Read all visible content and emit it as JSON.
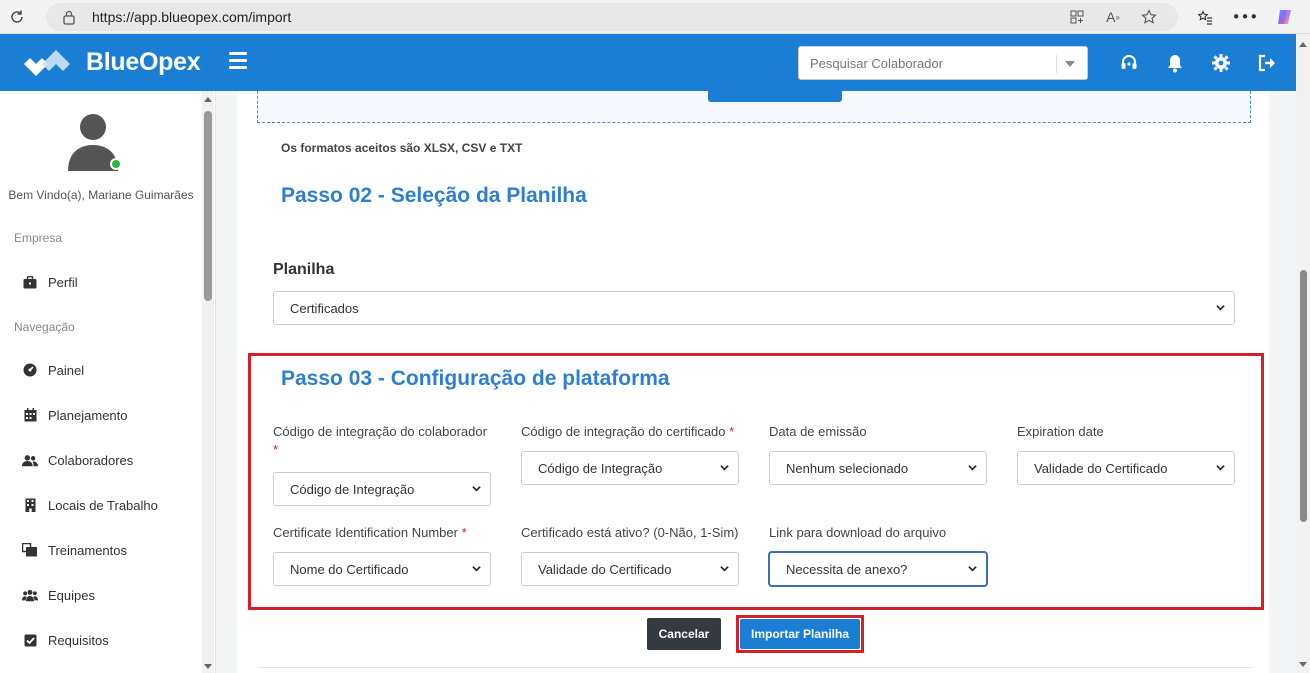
{
  "browser": {
    "url": "https://app.blueopex.com/import"
  },
  "header": {
    "brand": "BlueOpex",
    "search_placeholder": "Pesquisar Colaborador"
  },
  "sidebar": {
    "welcome": "Bem Vindo(a), Mariane Guimarães",
    "section_company": "Empresa",
    "section_nav": "Navegação",
    "items": [
      {
        "label": "Perfil",
        "icon": "briefcase-icon"
      },
      {
        "label": "Painel",
        "icon": "dashboard-icon"
      },
      {
        "label": "Planejamento",
        "icon": "calendar-icon"
      },
      {
        "label": "Colaboradores",
        "icon": "users-icon"
      },
      {
        "label": "Locais de Trabalho",
        "icon": "building-icon"
      },
      {
        "label": "Treinamentos",
        "icon": "training-icon"
      },
      {
        "label": "Equipes",
        "icon": "team-icon"
      },
      {
        "label": "Requisitos",
        "icon": "checkbox-icon"
      }
    ]
  },
  "main": {
    "formats_note": "Os formatos aceitos são XLSX, CSV e TXT",
    "step2_title": "Passo 02 - Seleção da Planilha",
    "sheet_label": "Planilha",
    "sheet_value": "Certificados",
    "step3_title": "Passo 03 - Configuração de plataforma",
    "fields": [
      {
        "label": "Código de integração do colaborador",
        "required": "*",
        "value": "Código de Integração"
      },
      {
        "label": "Código de integração do certificado",
        "required": "*",
        "value": "Código de Integração"
      },
      {
        "label": "Data de emissão",
        "required": "",
        "value": "Nenhum selecionado"
      },
      {
        "label": "Expiration date",
        "required": "",
        "value": "Validade do Certificado"
      },
      {
        "label": "Certificate Identification Number",
        "required": "*",
        "value": "Nome do Certificado"
      },
      {
        "label": "Certificado está ativo? (0-Não, 1-Sim)",
        "required": "",
        "value": "Validade do Certificado"
      },
      {
        "label": "Link para download do arquivo",
        "required": "",
        "value": "Necessita de anexo?"
      }
    ],
    "cancel_label": "Cancelar",
    "import_label": "Importar Planilha"
  },
  "colors": {
    "brand": "#1a7fd4",
    "step_title": "#2f7fd0",
    "highlight": "#d3202a",
    "cancel": "#343a40"
  }
}
